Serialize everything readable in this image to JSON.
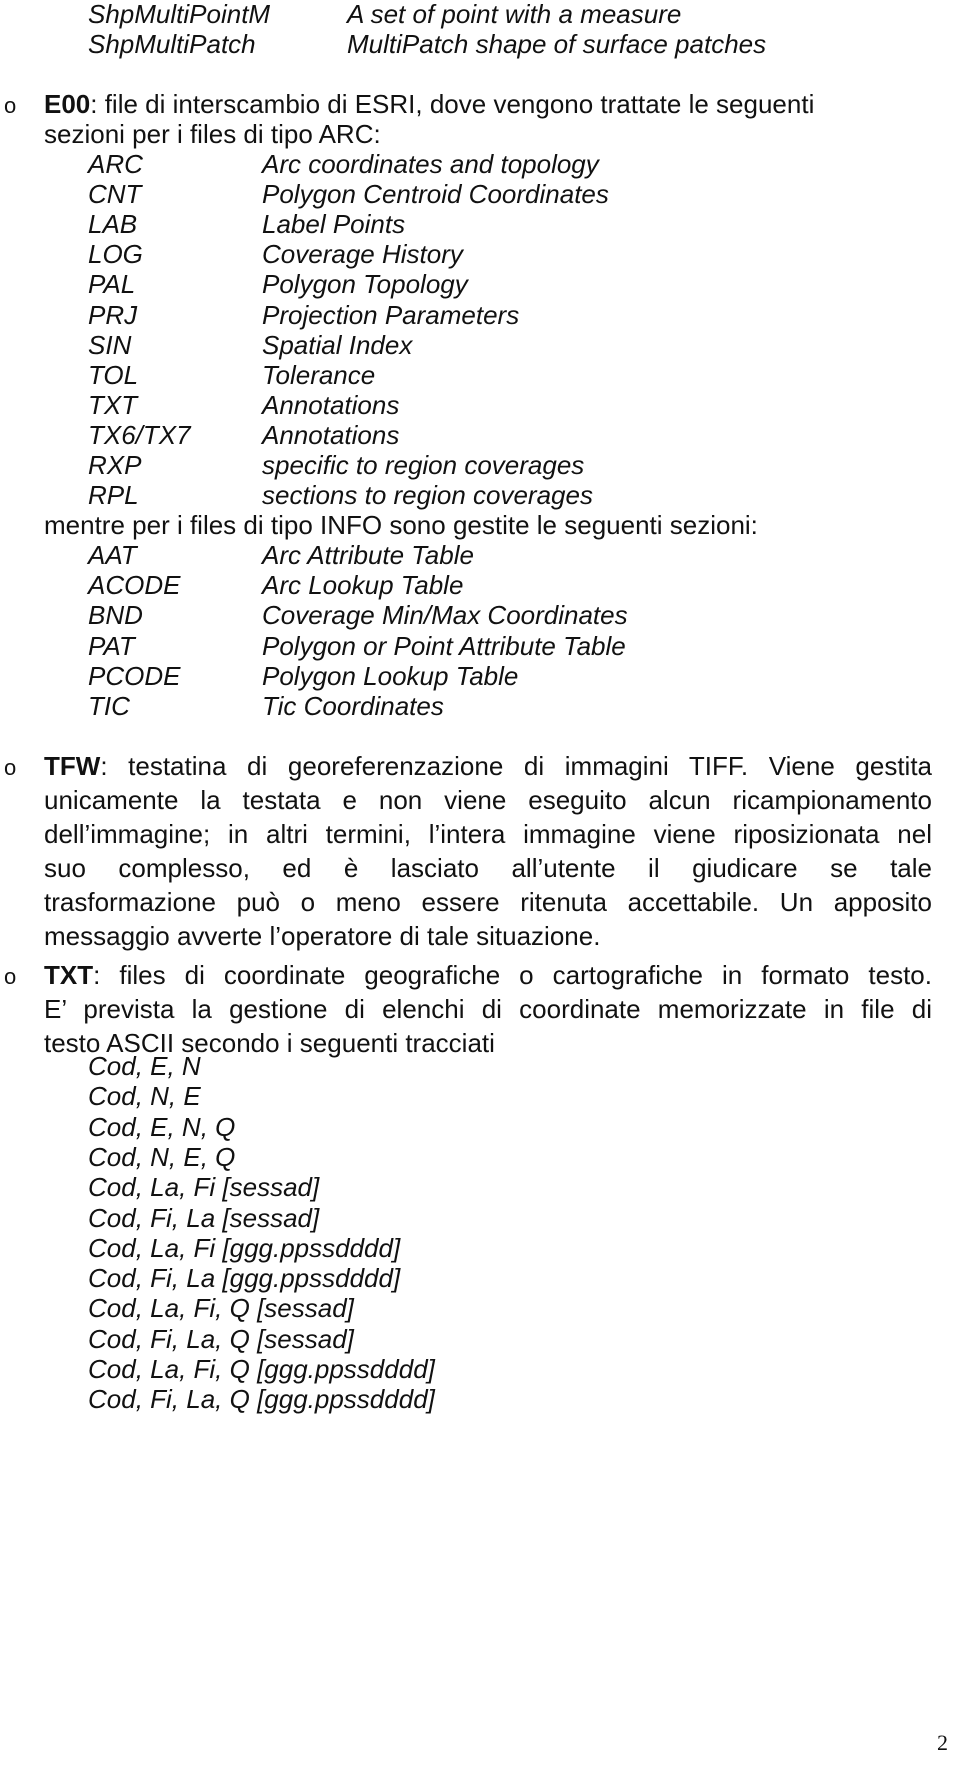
{
  "shp_rows": [
    {
      "code": "ShpMultiPointM",
      "desc": "A set of point  with a measure"
    },
    {
      "code": "ShpMultiPatch",
      "desc": "MultiPatch shape of surface patches"
    }
  ],
  "bullet_symbol": "o",
  "e00": {
    "keyword": "E00",
    "intro_line1": ": file di interscambio di ESRI, dove vengono trattate le seguenti",
    "intro_line2": "sezioni per i files di tipo ARC:",
    "arc_sections": [
      {
        "code": "ARC",
        "desc": "Arc coordinates and topology"
      },
      {
        "code": "CNT",
        "desc": "Polygon Centroid Coordinates"
      },
      {
        "code": "LAB",
        "desc": "Label Points"
      },
      {
        "code": "LOG",
        "desc": "Coverage History"
      },
      {
        "code": "PAL",
        "desc": "Polygon Topology"
      },
      {
        "code": "PRJ",
        "desc": "Projection Parameters"
      },
      {
        "code": "SIN",
        "desc": "Spatial Index"
      },
      {
        "code": "TOL",
        "desc": "Tolerance"
      },
      {
        "code": "TXT",
        "desc": "Annotations"
      },
      {
        "code": "TX6/TX7",
        "desc": "Annotations"
      },
      {
        "code": "RXP",
        "desc": "specific to region coverages"
      },
      {
        "code": "RPL",
        "desc": "sections to region coverages"
      }
    ],
    "info_intro": "mentre  per i files di tipo INFO sono gestite le seguenti sezioni:",
    "info_sections": [
      {
        "code": "AAT",
        "desc": "Arc Attribute Table"
      },
      {
        "code": "ACODE",
        "desc": "Arc Lookup Table"
      },
      {
        "code": "BND",
        "desc": "Coverage Min/Max Coordinates"
      },
      {
        "code": "PAT",
        "desc": "Polygon or Point Attribute Table"
      },
      {
        "code": "PCODE",
        "desc": "Polygon Lookup Table"
      },
      {
        "code": "TIC",
        "desc": "Tic Coordinates"
      }
    ]
  },
  "tfw": {
    "keyword": "TFW",
    "lines": [
      ": testatina di georeferenzazione di immagini TIFF. Viene gestita",
      "unicamente la testata e non viene eseguito alcun ricampionamento",
      "dell’immagine; in altri termini, l’intera immagine viene riposizionata nel",
      "suo complesso, ed è lasciato all’utente il giudicare se tale",
      "trasformazione può o meno essere ritenuta accettabile. Un apposito",
      "messaggio avverte l’operatore di tale situazione."
    ]
  },
  "txt": {
    "keyword": "TXT",
    "lines": [
      ": files di coordinate geografiche o cartografiche in formato testo.",
      "E’ prevista la gestione di elenchi di coordinate memorizzate in file di",
      "testo ASCII secondo i seguenti tracciati"
    ],
    "formats": [
      "Cod, E, N",
      "Cod, N, E",
      "Cod, E, N, Q",
      "Cod, N, E, Q",
      "Cod, La, Fi [sessad]",
      "Cod, Fi, La [sessad]",
      "Cod, La, Fi [ggg.ppssdddd]",
      "Cod, Fi, La [ggg.ppssdddd]",
      "Cod, La, Fi, Q [sessad]",
      "Cod, Fi, La, Q [sessad]",
      "Cod, La, Fi, Q [ggg.ppssdddd]",
      "Cod, Fi, La, Q [ggg.ppssdddd]"
    ]
  },
  "page_number": "2"
}
